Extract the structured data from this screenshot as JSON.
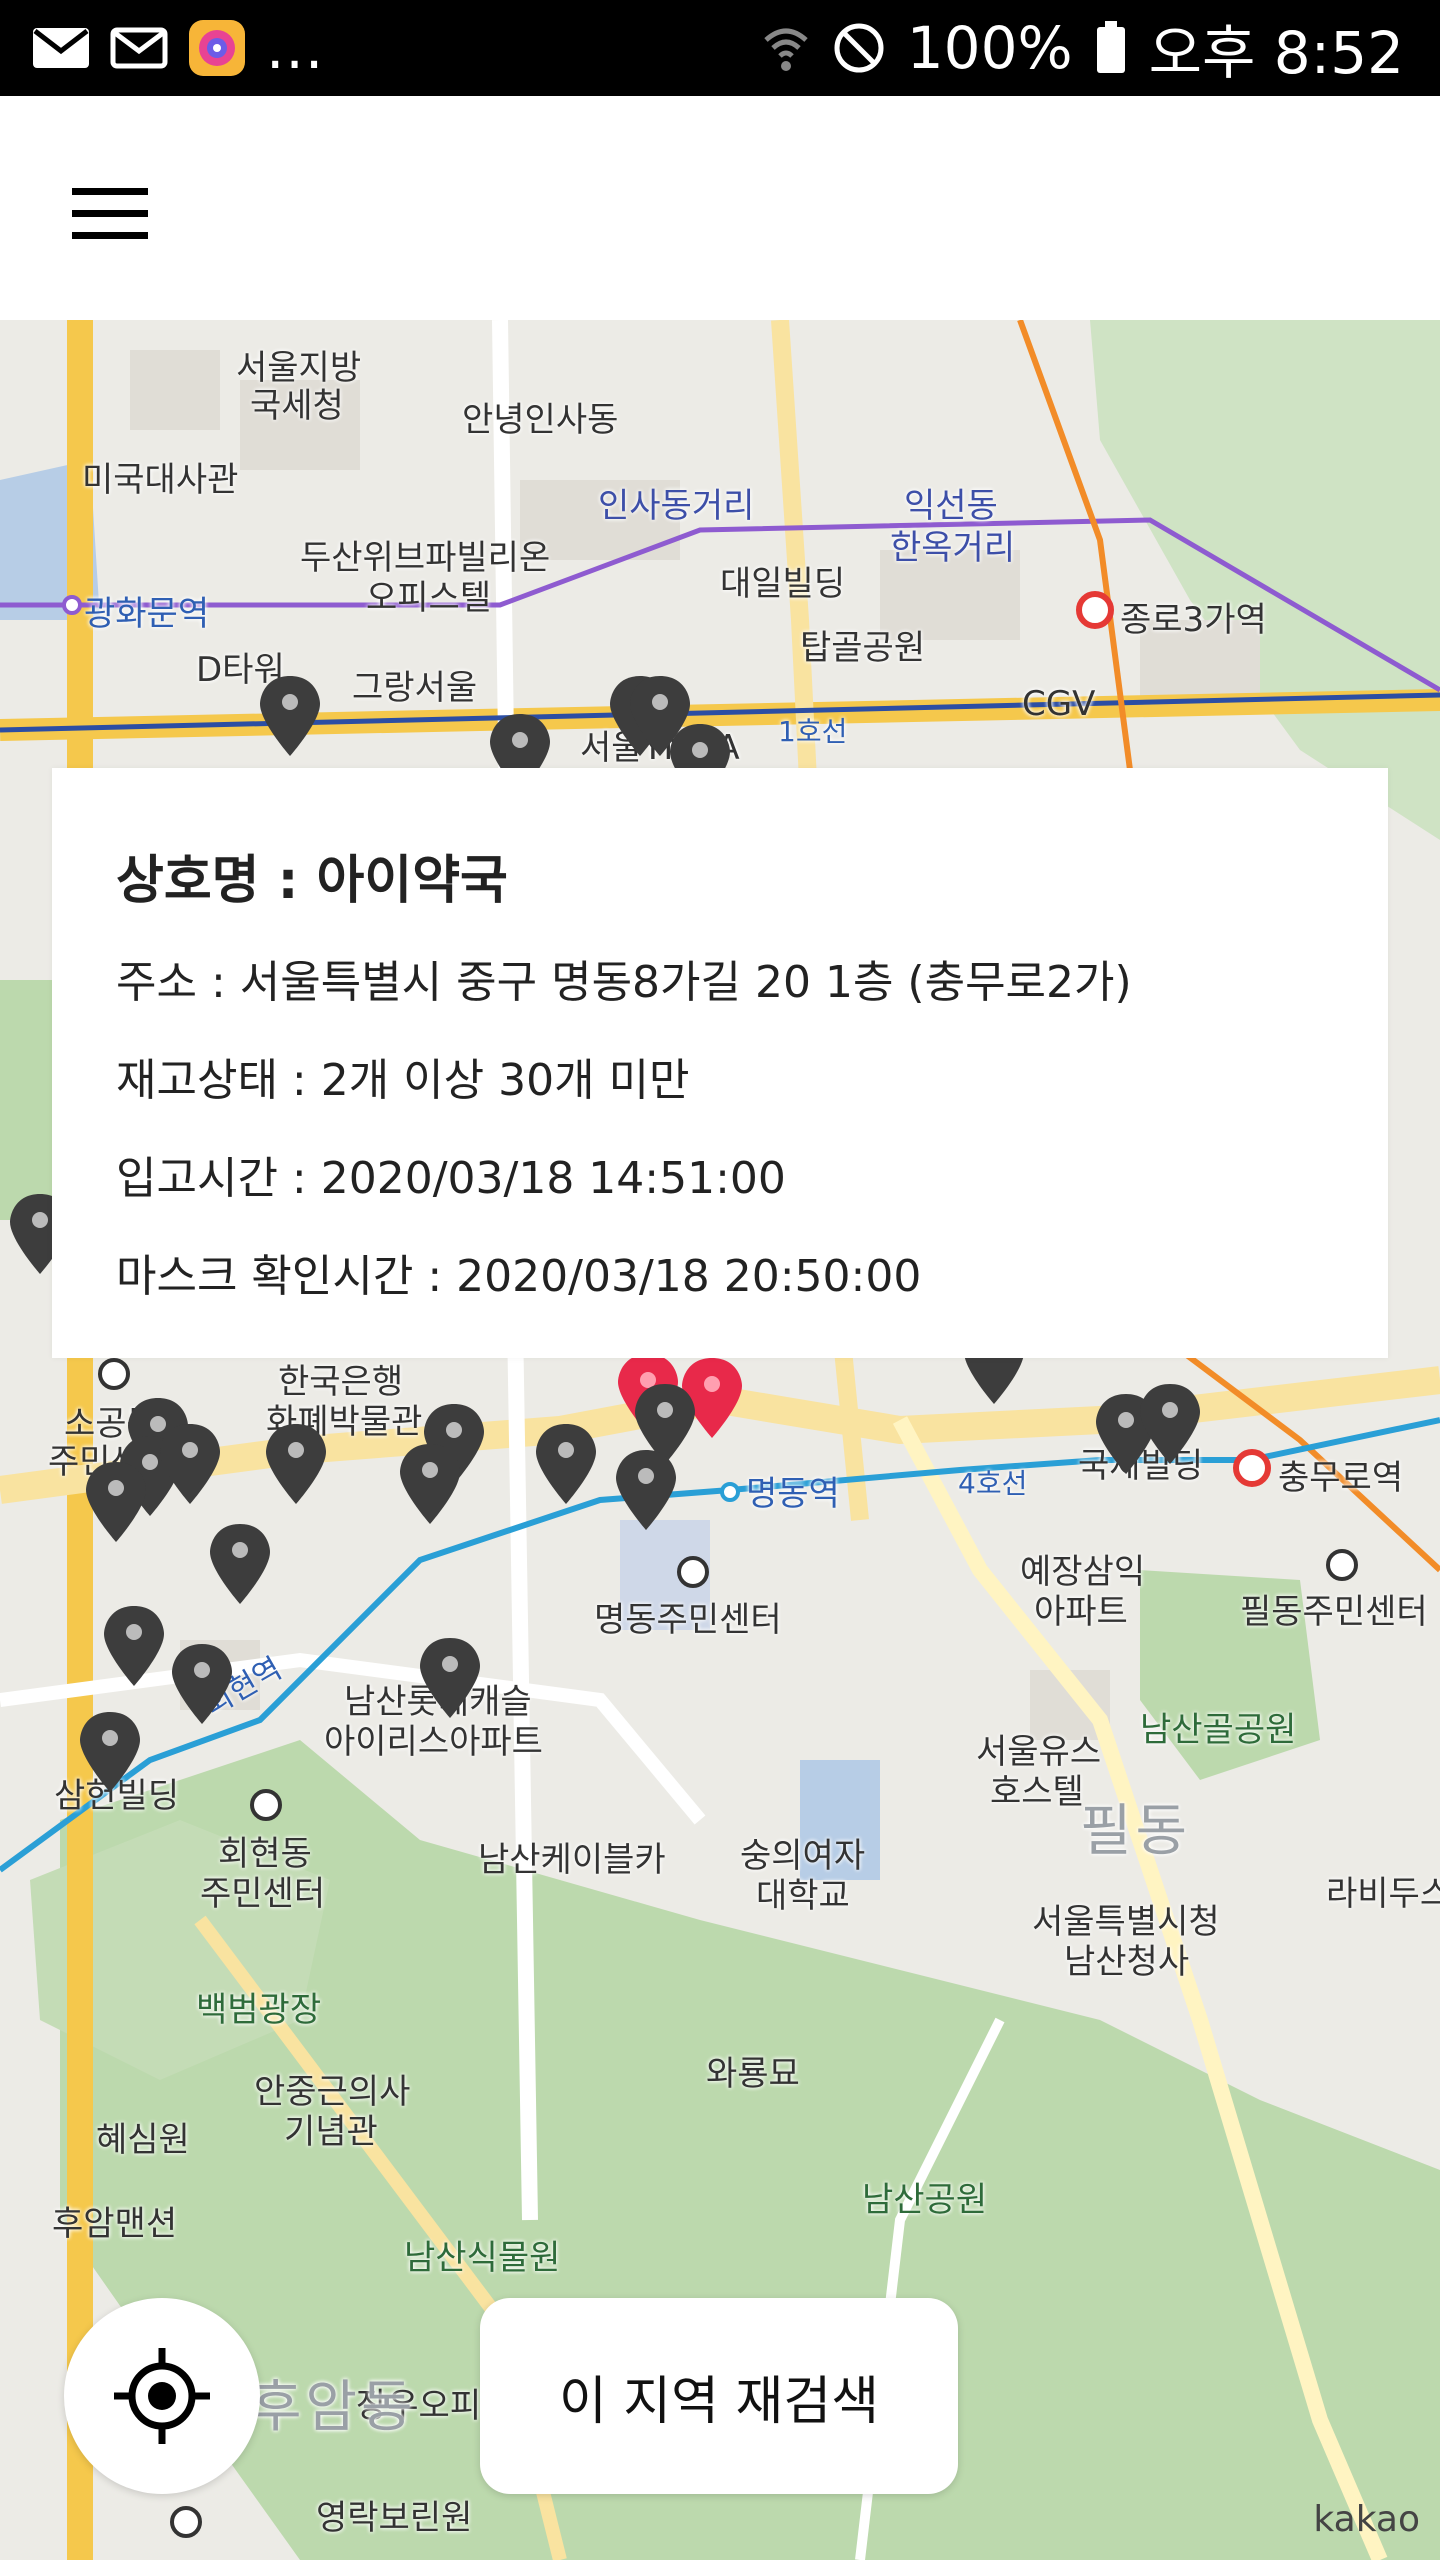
{
  "status_bar": {
    "overflow": "...",
    "battery": "100%",
    "time": "오후 8:52"
  },
  "app_bar": {
    "menu_icon": "hamburger-menu-icon"
  },
  "map": {
    "attribution": "kakao",
    "labels": [
      {
        "text": "서울지방",
        "cls": ""
      },
      {
        "text": "국세청",
        "cls": ""
      },
      {
        "text": "안녕인사동",
        "cls": ""
      },
      {
        "text": "미국대사관",
        "cls": ""
      },
      {
        "text": "인사동거리",
        "cls": "blue"
      },
      {
        "text": "익선동",
        "cls": "blue"
      },
      {
        "text": "한옥거리",
        "cls": "blue"
      },
      {
        "text": "두산위브파빌리온",
        "cls": ""
      },
      {
        "text": "오피스텔",
        "cls": ""
      },
      {
        "text": "대일빌딩",
        "cls": ""
      },
      {
        "text": "광화문역",
        "cls": "stn"
      },
      {
        "text": "종로3가역",
        "cls": ""
      },
      {
        "text": "탑골공원",
        "cls": ""
      },
      {
        "text": "D타워",
        "cls": ""
      },
      {
        "text": "그랑서울",
        "cls": ""
      },
      {
        "text": "CGV",
        "cls": ""
      },
      {
        "text": "1호선",
        "cls": "stn"
      },
      {
        "text": "서울YMCA",
        "cls": ""
      },
      {
        "text": "한국은행",
        "cls": ""
      },
      {
        "text": "화폐박물관",
        "cls": ""
      },
      {
        "text": "소공동",
        "cls": ""
      },
      {
        "text": "주민센터",
        "cls": ""
      },
      {
        "text": "명동역",
        "cls": "stn"
      },
      {
        "text": "4호선",
        "cls": "stn"
      },
      {
        "text": "국제빌딩",
        "cls": ""
      },
      {
        "text": "충무로역",
        "cls": ""
      },
      {
        "text": "예장삼익",
        "cls": ""
      },
      {
        "text": "아파트",
        "cls": ""
      },
      {
        "text": "필동주민센터",
        "cls": ""
      },
      {
        "text": "명동주민센터",
        "cls": ""
      },
      {
        "text": "회현역",
        "cls": "stn"
      },
      {
        "text": "남산롯데캐슬",
        "cls": ""
      },
      {
        "text": "아이리스아파트",
        "cls": ""
      },
      {
        "text": "서울유스",
        "cls": ""
      },
      {
        "text": "호스텔",
        "cls": ""
      },
      {
        "text": "남산골공원",
        "cls": "green"
      },
      {
        "text": "삼헌빌딩",
        "cls": ""
      },
      {
        "text": "회현동",
        "cls": ""
      },
      {
        "text": "주민센터",
        "cls": ""
      },
      {
        "text": "남산케이블카",
        "cls": ""
      },
      {
        "text": "숭의여자",
        "cls": ""
      },
      {
        "text": "대학교",
        "cls": ""
      },
      {
        "text": "필동",
        "cls": "big"
      },
      {
        "text": "라비두스",
        "cls": ""
      },
      {
        "text": "서울특별시청",
        "cls": ""
      },
      {
        "text": "남산청사",
        "cls": ""
      },
      {
        "text": "백범광장",
        "cls": "green"
      },
      {
        "text": "와룡묘",
        "cls": ""
      },
      {
        "text": "안중근의사",
        "cls": ""
      },
      {
        "text": "기념관",
        "cls": ""
      },
      {
        "text": "혜심원",
        "cls": ""
      },
      {
        "text": "남산공원",
        "cls": "green"
      },
      {
        "text": "후암맨션",
        "cls": ""
      },
      {
        "text": "남산식물원",
        "cls": "green"
      },
      {
        "text": "장우오피",
        "cls": ""
      },
      {
        "text": "영락보린원",
        "cls": ""
      },
      {
        "text": "후암동",
        "cls": "big"
      }
    ]
  },
  "info_card": {
    "title": "상호명 : 아이약국",
    "address": "주소 : 서울특별시 중구 명동8가길 20 1층 (충무로2가)",
    "stock": "재고상태 : 2개 이상 30개 미만",
    "stocked_time": "입고시간 : 2020/03/18 14:51:00",
    "checked_time": "마스크 확인시간 : 2020/03/18 20:50:00"
  },
  "controls": {
    "locate_icon": "my-location-icon",
    "research_label": "이 지역 재검색"
  }
}
